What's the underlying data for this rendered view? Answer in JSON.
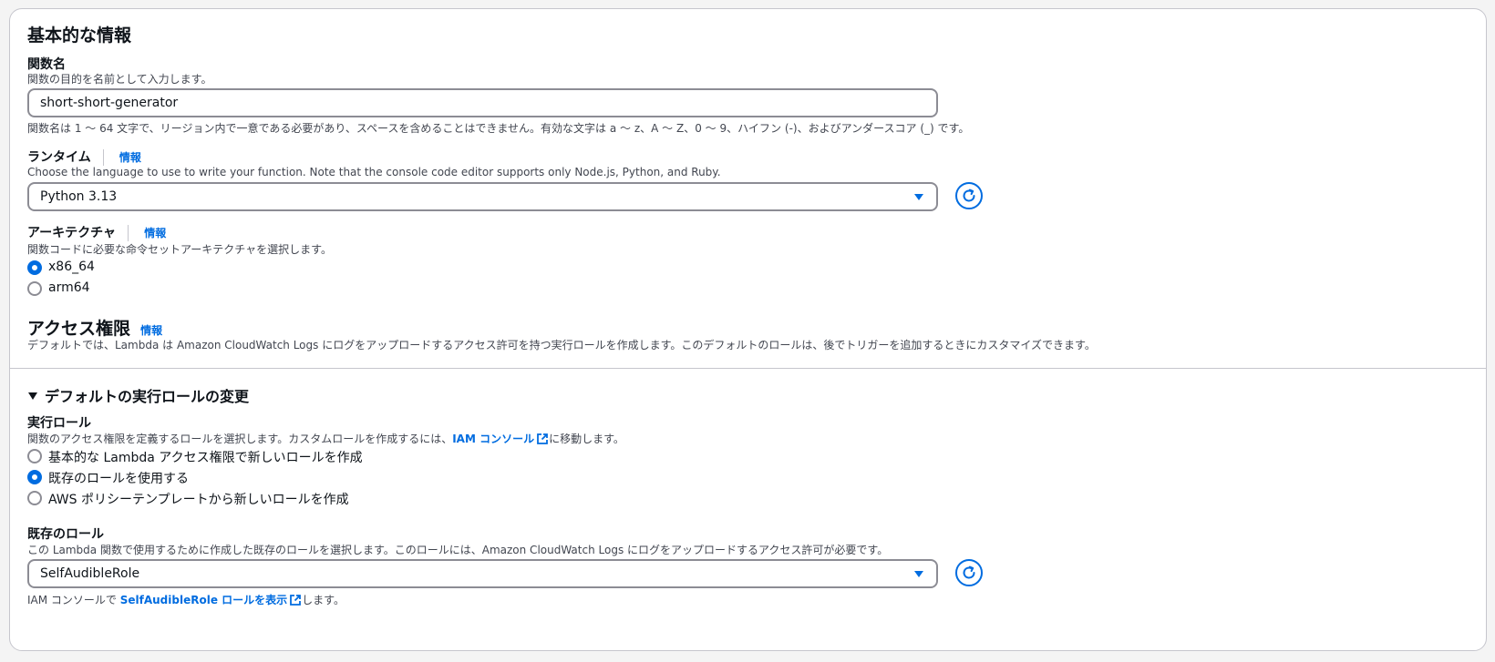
{
  "basic": {
    "heading": "基本的な情報",
    "function_name": {
      "label": "関数名",
      "description": "関数の目的を名前として入力します。",
      "value": "short-short-generator",
      "constraint": "関数名は 1 〜 64 文字で、リージョン内で一意である必要があり、スペースを含めることはできません。有効な文字は a 〜 z、A 〜 Z、0 〜 9、ハイフン (-)、およびアンダースコア (_) です。"
    },
    "runtime": {
      "label": "ランタイム",
      "info": "情報",
      "description": "Choose the language to use to write your function. Note that the console code editor supports only Node.js, Python, and Ruby.",
      "selected": "Python 3.13"
    },
    "architecture": {
      "label": "アーキテクチャ",
      "info": "情報",
      "description": "関数コードに必要な命令セットアーキテクチャを選択します。",
      "options": [
        {
          "label": "x86_64",
          "selected": true
        },
        {
          "label": "arm64",
          "selected": false
        }
      ]
    }
  },
  "permissions": {
    "heading": "アクセス権限",
    "info": "情報",
    "description": "デフォルトでは、Lambda は Amazon CloudWatch Logs にログをアップロードするアクセス許可を持つ実行ロールを作成します。このデフォルトのロールは、後でトリガーを追加するときにカスタマイズできます。"
  },
  "default_role": {
    "toggle_label": "デフォルトの実行ロールの変更",
    "execution_role": {
      "label": "実行ロール",
      "description_before": "関数のアクセス権限を定義するロールを選択します。カスタムロールを作成するには、",
      "link": "IAM コンソール",
      "description_after": "に移動します。",
      "options": [
        {
          "label": "基本的な Lambda アクセス権限で新しいロールを作成",
          "selected": false
        },
        {
          "label": "既存のロールを使用する",
          "selected": true
        },
        {
          "label": "AWS ポリシーテンプレートから新しいロールを作成",
          "selected": false
        }
      ]
    },
    "existing_role": {
      "label": "既存のロール",
      "description": "この Lambda 関数で使用するために作成した既存のロールを選択します。このロールには、Amazon CloudWatch Logs にログをアップロードするアクセス許可が必要です。",
      "selected": "SelfAudibleRole",
      "footer_before": "IAM コンソールで ",
      "footer_link": "SelfAudibleRole ロールを表示",
      "footer_after": "します。"
    }
  },
  "icons": {
    "refresh": "refresh-icon",
    "external": "external-link-icon"
  },
  "colors": {
    "accent": "#006ce0",
    "border": "#8c8c94"
  }
}
